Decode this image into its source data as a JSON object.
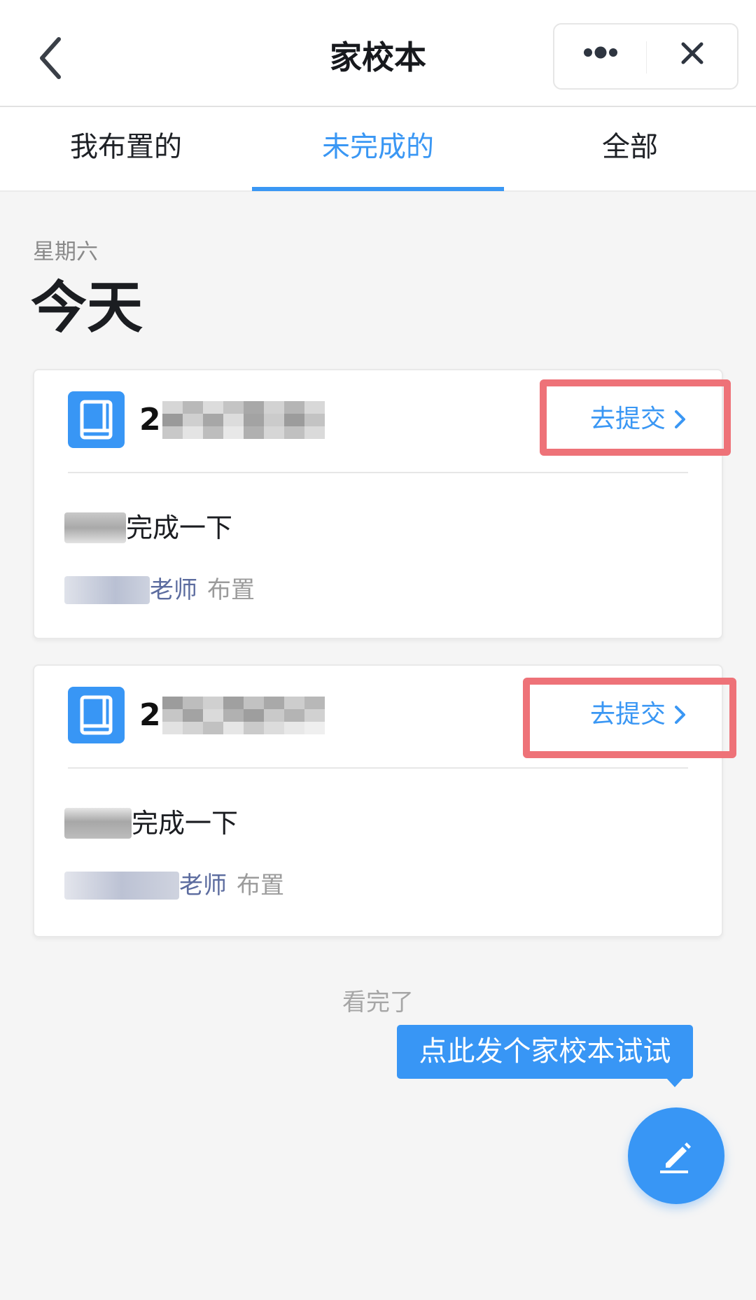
{
  "header": {
    "title": "家校本",
    "back_icon": "chevron-left-icon",
    "more_icon": "more-dots-icon",
    "close_icon": "close-icon"
  },
  "tabs": [
    {
      "label": "我布置的",
      "active": false
    },
    {
      "label": "未完成的",
      "active": true
    },
    {
      "label": "全部",
      "active": false
    }
  ],
  "section": {
    "weekday": "星期六",
    "day_label": "今天"
  },
  "cards": [
    {
      "icon": "book-icon",
      "title_visible": "2",
      "title_redacted": true,
      "action_label": "去提交",
      "action_icon": "chevron-right-icon",
      "content_visible": "完成一下",
      "content_redacted_prefix": true,
      "teacher_visible": "老师",
      "teacher_redacted_prefix": true,
      "assign_label": "布置",
      "highlighted": true
    },
    {
      "icon": "book-icon",
      "title_visible": "2",
      "title_redacted": true,
      "action_label": "去提交",
      "action_icon": "chevron-right-icon",
      "content_visible": "完成一下",
      "content_redacted_prefix": true,
      "teacher_visible": "老师",
      "teacher_redacted_prefix": true,
      "assign_label": "布置",
      "highlighted": true
    }
  ],
  "footer": {
    "end_text": "看完了",
    "tooltip": "点此发个家校本试试",
    "fab_icon": "pencil-edit-icon"
  },
  "colors": {
    "accent": "#3896f5",
    "annotation": "#ee7278",
    "teacher_name": "#5c6c9f",
    "background": "#f5f5f5"
  }
}
